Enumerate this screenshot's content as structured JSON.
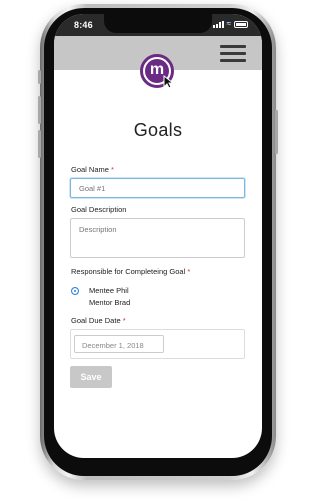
{
  "status_bar": {
    "time": "8:46"
  },
  "page": {
    "title": "Goals"
  },
  "form": {
    "goal_name": {
      "label": "Goal Name",
      "required_mark": "*",
      "placeholder": "Goal #1"
    },
    "goal_description": {
      "label": "Goal Description",
      "placeholder": "Description"
    },
    "responsible": {
      "label": "Responsible for Completeing Goal",
      "required_mark": "*",
      "options": [
        {
          "label": "Mentee Phil",
          "selected": true
        },
        {
          "label": "Mentor Brad",
          "selected": false
        }
      ]
    },
    "due_date": {
      "label": "Goal Due Date",
      "required_mark": "*",
      "placeholder": "December 1, 2018"
    },
    "save_label": "Save"
  },
  "colors": {
    "brand_purple": "#6b2a83",
    "app_bar": "#c6c6c6",
    "radio_selected": "#2e86de",
    "required": "#c0392b"
  },
  "icons": {
    "logo": "m-logo-icon",
    "menu": "hamburger-menu-icon"
  }
}
